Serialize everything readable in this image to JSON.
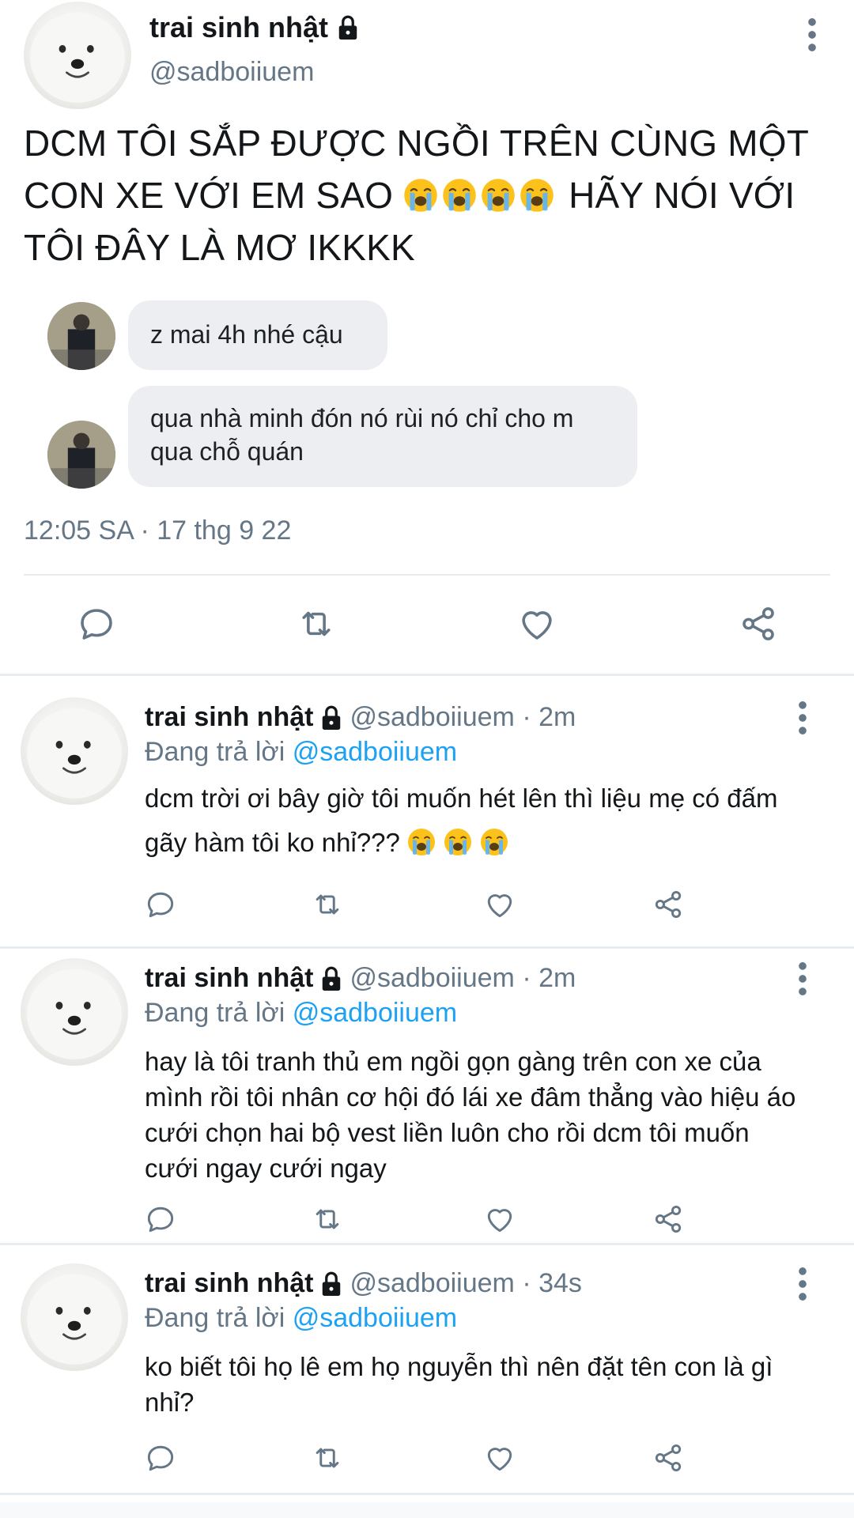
{
  "main_tweet": {
    "display_name": "trai sinh nhật",
    "handle": "@sadboiiuem",
    "text_part1": "DCM TÔI SẮP ĐƯỢC NGỒI TRÊN CÙNG MỘT CON XE VỚI EM SAO",
    "emoji_count": 4,
    "text_part2": "HÃY NÓI VỚI TÔI ĐÂY LÀ MƠ IKKKK",
    "chat_messages": [
      {
        "text": "z mai 4h nhé cậu"
      },
      {
        "text": "qua nhà minh đón nó rùi nó chỉ cho m qua chỗ quán"
      }
    ],
    "timestamp": "12:05 SA · 17 thg 9 22"
  },
  "replies": [
    {
      "display_name": "trai sinh nhật",
      "meta": "@sadboiiuem · 2m",
      "replying_prefix": "Đang trả lời",
      "replying_to": "@sadboiiuem",
      "text": "dcm trời ơi bây giờ tôi muốn hét lên thì liệu mẹ có đấm gãy hàm tôi ko nhỉ???"
    },
    {
      "display_name": "trai sinh nhật",
      "meta": "@sadboiiuem · 2m",
      "replying_prefix": "Đang trả lời",
      "replying_to": "@sadboiiuem",
      "text": "hay là tôi tranh thủ em ngồi gọn gàng trên con xe của mình rồi tôi nhân cơ hội đó lái xe đâm thẳng vào hiệu áo cưới chọn hai bộ vest liền luôn cho rồi dcm tôi muốn cưới ngay cưới ngay"
    },
    {
      "display_name": "trai sinh nhật",
      "meta": "@sadboiiuem · 34s",
      "replying_prefix": "Đang trả lời",
      "replying_to": "@sadboiiuem",
      "text": "ko biết tôi họ lê em họ nguyễn thì nên đặt tên con là gì nhỉ?"
    }
  ],
  "icons": {
    "lock": "lock-icon",
    "more": "more-vertical-icon",
    "reply": "reply-icon",
    "retweet": "retweet-icon",
    "like": "heart-icon",
    "share": "share-icon",
    "emoji": "loudly-crying-face-emoji"
  },
  "colors": {
    "primary_text": "#14171a",
    "secondary_text": "#657786",
    "link": "#1da1f2",
    "bubble": "#eceef2",
    "divider": "#e6ecf0",
    "icon": "#657786"
  }
}
